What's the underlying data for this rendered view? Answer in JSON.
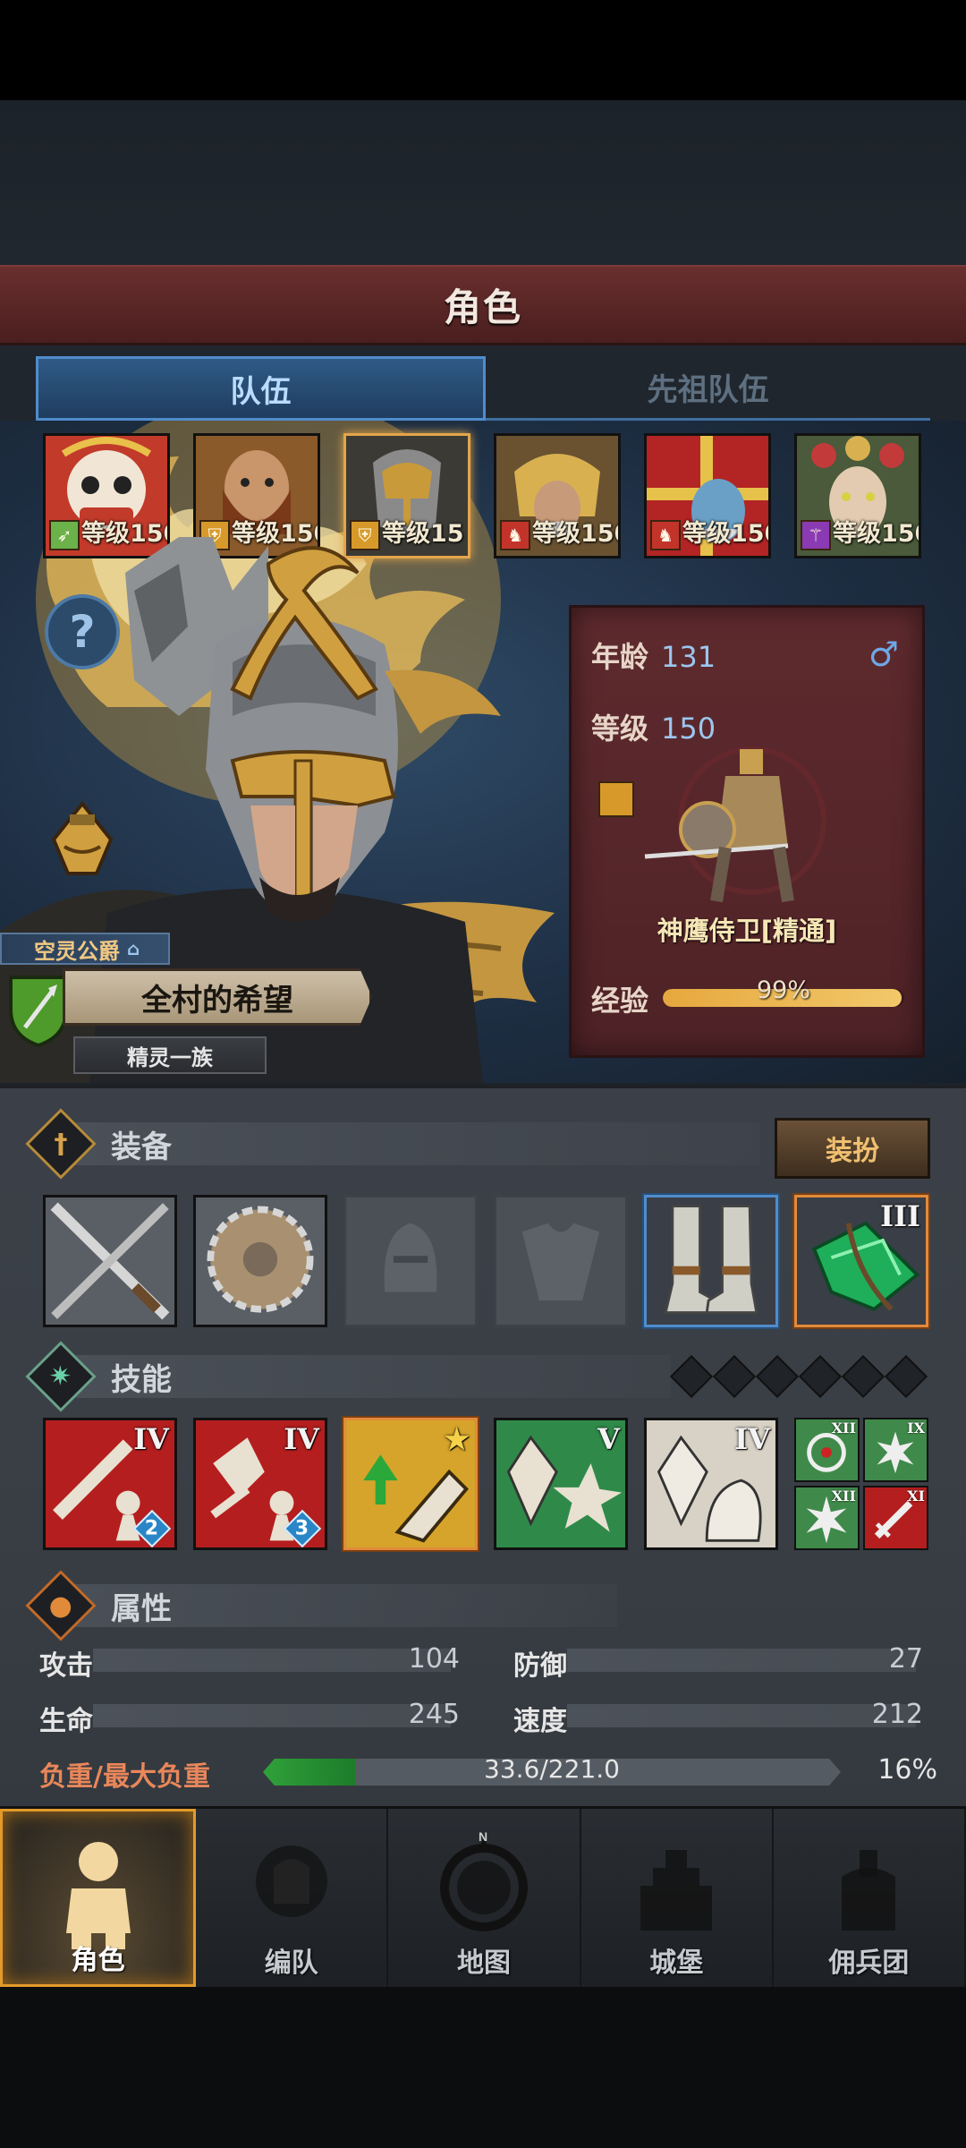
{
  "header": {
    "title": "角色"
  },
  "tabs": [
    {
      "label": "队伍",
      "active": true
    },
    {
      "label": "先祖队伍",
      "active": false
    }
  ],
  "team": [
    {
      "name_icon": "lion-dance-hero",
      "class_icon": "bow-icon",
      "level": "等级150"
    },
    {
      "name_icon": "bearded-warrior",
      "class_icon": "shield-icon",
      "level": "等级150"
    },
    {
      "name_icon": "eagle-helmet-knight",
      "class_icon": "shield-icon",
      "level": "等级15",
      "selected": true
    },
    {
      "name_icon": "golden-paladin",
      "class_icon": "horse-icon",
      "level": "等级150"
    },
    {
      "name_icon": "gift-box-wizard",
      "class_icon": "horse-icon",
      "level": "等级150"
    },
    {
      "name_icon": "flower-elf-queen",
      "class_icon": "staff-icon",
      "level": "等级150"
    }
  ],
  "hero": {
    "title_tag": "空灵公爵",
    "name": "全村的希望",
    "race": "精灵一族"
  },
  "info": {
    "age_label": "年龄",
    "age_value": "131",
    "gender_icon": "male-symbol-icon",
    "gender": "♂",
    "level_label": "等级",
    "level_value": "150",
    "unit_name": "神鹰侍卫[精通]",
    "exp_label": "经验",
    "exp_text": "99%",
    "exp_percent": 99
  },
  "equipment": {
    "title": "装备",
    "outfit_button": "装扮",
    "slots": [
      {
        "name": "crossed-swords-icon",
        "state": "filled"
      },
      {
        "name": "bladed-shield-icon",
        "state": "filled"
      },
      {
        "name": "helmet-slot-icon",
        "state": "empty"
      },
      {
        "name": "armor-slot-icon",
        "state": "empty"
      },
      {
        "name": "steel-boots-icon",
        "state": "blue"
      },
      {
        "name": "green-crystal-icon",
        "state": "orange",
        "rank": "III"
      }
    ]
  },
  "skills": {
    "title": "技能",
    "slots": [
      {
        "name": "sword-strike-icon",
        "rank": "IV",
        "badge": "2"
      },
      {
        "name": "shatter-strike-icon",
        "rank": "IV",
        "badge": "3"
      },
      {
        "name": "gold-rush-icon",
        "rank": "★"
      },
      {
        "name": "crystal-burst-icon",
        "rank": "V"
      },
      {
        "name": "crystal-hand-icon",
        "rank": "IV"
      }
    ],
    "mini": [
      {
        "name": "target-icon",
        "rank": "XII"
      },
      {
        "name": "burst-icon",
        "rank": "IX"
      },
      {
        "name": "spark-icon",
        "rank": "XII"
      },
      {
        "name": "red-sword-icon",
        "rank": "XI"
      }
    ]
  },
  "attributes": {
    "title": "属性",
    "attack_label": "攻击",
    "attack": "104",
    "defense_label": "防御",
    "defense": "27",
    "hp_label": "生命",
    "hp": "245",
    "speed_label": "速度",
    "speed": "212",
    "load_label": "负重/最大负重",
    "load_text": "33.6/221.0",
    "load_pct": "16%",
    "load_fraction": 0.16
  },
  "nav": [
    {
      "label": "角色",
      "active": true
    },
    {
      "label": "编队"
    },
    {
      "label": "地图"
    },
    {
      "label": "城堡"
    },
    {
      "label": "佣兵团"
    }
  ],
  "colors": {
    "accent": "#e39a2a",
    "header": "#5a2626",
    "tab_active": "#2f5a86"
  }
}
